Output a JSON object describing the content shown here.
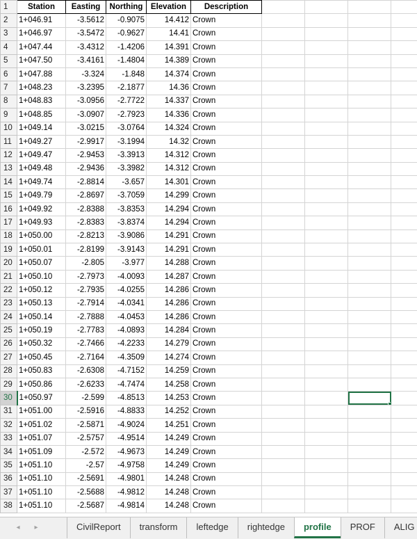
{
  "headers": [
    "Station",
    "Easting",
    "Northing",
    "Elevation",
    "Description"
  ],
  "active_row": 30,
  "rows": [
    [
      "1+046.91",
      "-3.5612",
      "-0.9075",
      "14.412",
      "Crown"
    ],
    [
      "1+046.97",
      "-3.5472",
      "-0.9627",
      "14.41",
      "Crown"
    ],
    [
      "1+047.44",
      "-3.4312",
      "-1.4206",
      "14.391",
      "Crown"
    ],
    [
      "1+047.50",
      "-3.4161",
      "-1.4804",
      "14.389",
      "Crown"
    ],
    [
      "1+047.88",
      "-3.324",
      "-1.848",
      "14.374",
      "Crown"
    ],
    [
      "1+048.23",
      "-3.2395",
      "-2.1877",
      "14.36",
      "Crown"
    ],
    [
      "1+048.83",
      "-3.0956",
      "-2.7722",
      "14.337",
      "Crown"
    ],
    [
      "1+048.85",
      "-3.0907",
      "-2.7923",
      "14.336",
      "Crown"
    ],
    [
      "1+049.14",
      "-3.0215",
      "-3.0764",
      "14.324",
      "Crown"
    ],
    [
      "1+049.27",
      "-2.9917",
      "-3.1994",
      "14.32",
      "Crown"
    ],
    [
      "1+049.47",
      "-2.9453",
      "-3.3913",
      "14.312",
      "Crown"
    ],
    [
      "1+049.48",
      "-2.9436",
      "-3.3982",
      "14.312",
      "Crown"
    ],
    [
      "1+049.74",
      "-2.8814",
      "-3.657",
      "14.301",
      "Crown"
    ],
    [
      "1+049.79",
      "-2.8697",
      "-3.7059",
      "14.299",
      "Crown"
    ],
    [
      "1+049.92",
      "-2.8388",
      "-3.8353",
      "14.294",
      "Crown"
    ],
    [
      "1+049.93",
      "-2.8383",
      "-3.8374",
      "14.294",
      "Crown"
    ],
    [
      "1+050.00",
      "-2.8213",
      "-3.9086",
      "14.291",
      "Crown"
    ],
    [
      "1+050.01",
      "-2.8199",
      "-3.9143",
      "14.291",
      "Crown"
    ],
    [
      "1+050.07",
      "-2.805",
      "-3.977",
      "14.288",
      "Crown"
    ],
    [
      "1+050.10",
      "-2.7973",
      "-4.0093",
      "14.287",
      "Crown"
    ],
    [
      "1+050.12",
      "-2.7935",
      "-4.0255",
      "14.286",
      "Crown"
    ],
    [
      "1+050.13",
      "-2.7914",
      "-4.0341",
      "14.286",
      "Crown"
    ],
    [
      "1+050.14",
      "-2.7888",
      "-4.0453",
      "14.286",
      "Crown"
    ],
    [
      "1+050.19",
      "-2.7783",
      "-4.0893",
      "14.284",
      "Crown"
    ],
    [
      "1+050.32",
      "-2.7466",
      "-4.2233",
      "14.279",
      "Crown"
    ],
    [
      "1+050.45",
      "-2.7164",
      "-4.3509",
      "14.274",
      "Crown"
    ],
    [
      "1+050.83",
      "-2.6308",
      "-4.7152",
      "14.259",
      "Crown"
    ],
    [
      "1+050.86",
      "-2.6233",
      "-4.7474",
      "14.258",
      "Crown"
    ],
    [
      "1+050.97",
      "-2.599",
      "-4.8513",
      "14.253",
      "Crown"
    ],
    [
      "1+051.00",
      "-2.5916",
      "-4.8833",
      "14.252",
      "Crown"
    ],
    [
      "1+051.02",
      "-2.5871",
      "-4.9024",
      "14.251",
      "Crown"
    ],
    [
      "1+051.07",
      "-2.5757",
      "-4.9514",
      "14.249",
      "Crown"
    ],
    [
      "1+051.09",
      "-2.572",
      "-4.9673",
      "14.249",
      "Crown"
    ],
    [
      "1+051.10",
      "-2.57",
      "-4.9758",
      "14.249",
      "Crown"
    ],
    [
      "1+051.10",
      "-2.5691",
      "-4.9801",
      "14.248",
      "Crown"
    ],
    [
      "1+051.10",
      "-2.5688",
      "-4.9812",
      "14.248",
      "Crown"
    ],
    [
      "1+051.10",
      "-2.5687",
      "-4.9814",
      "14.248",
      "Crown"
    ]
  ],
  "nav": {
    "prev_icon": "◂",
    "next_icon": "▸"
  },
  "tabs": [
    {
      "label": "CivilReport",
      "active": false
    },
    {
      "label": "transform",
      "active": false
    },
    {
      "label": "leftedge",
      "active": false
    },
    {
      "label": "rightedge",
      "active": false
    },
    {
      "label": "profile",
      "active": true
    },
    {
      "label": "PROF",
      "active": false
    },
    {
      "label": "ALIG",
      "active": false
    }
  ],
  "colors": {
    "accent": "#217346",
    "gridline": "#d4d4d4",
    "header_bg": "#f3f3f3"
  }
}
